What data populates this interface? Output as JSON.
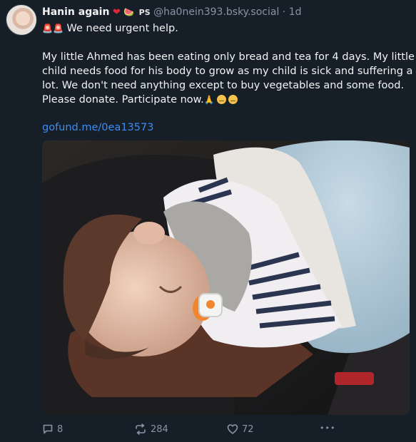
{
  "author": {
    "display_name": "Hanin again",
    "badge_heart": "❤",
    "badge_melon": "🍉",
    "badge_ps": "PS",
    "handle": "@ha0nein393.bsky.social",
    "separator": "·",
    "time": "1d"
  },
  "post": {
    "siren": "🚨🚨",
    "line1": "We need urgent help.",
    "paragraph_lines": [
      "My little Ahmed has been eating only bread and tea for 4 days. My little",
      "child needs food for his body to grow as my child is sick and suffering a",
      "lot. We don't need anything except to buy vegetables and some food.",
      "Please donate. Participate now."
    ],
    "pray_emoji": "🙏",
    "link": "gofund.me/0ea13573"
  },
  "actions": {
    "replies": "8",
    "reposts": "284",
    "likes": "72",
    "more": "•••"
  },
  "colors": {
    "background": "#161e27",
    "link": "#3b8cf4",
    "muted": "#8795a8"
  }
}
